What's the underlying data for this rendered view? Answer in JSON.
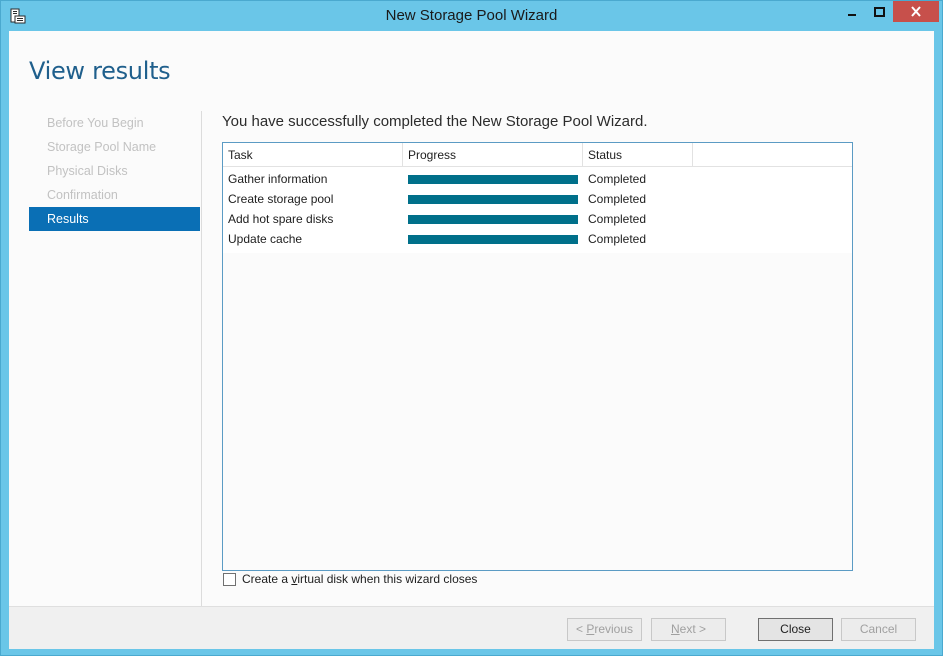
{
  "window": {
    "title": "New Storage Pool Wizard"
  },
  "page": {
    "title": "View results",
    "headline": "You have successfully completed the New Storage Pool Wizard."
  },
  "nav": {
    "items": [
      {
        "label": "Before You Begin",
        "state": "disabled"
      },
      {
        "label": "Storage Pool Name",
        "state": "disabled"
      },
      {
        "label": "Physical Disks",
        "state": "disabled"
      },
      {
        "label": "Confirmation",
        "state": "disabled"
      },
      {
        "label": "Results",
        "state": "active"
      }
    ]
  },
  "grid": {
    "columns": {
      "task": "Task",
      "progress": "Progress",
      "status": "Status"
    },
    "rows": [
      {
        "task": "Gather information",
        "progress": 1.0,
        "status": "Completed"
      },
      {
        "task": "Create storage pool",
        "progress": 1.0,
        "status": "Completed"
      },
      {
        "task": "Add hot spare disks",
        "progress": 1.0,
        "status": "Completed"
      },
      {
        "task": "Update cache",
        "progress": 1.0,
        "status": "Completed"
      }
    ]
  },
  "options": {
    "create_vdisk_pre": "Create a ",
    "create_vdisk_accel": "v",
    "create_vdisk_post": "irtual disk when this wizard closes",
    "create_vdisk_checked": false
  },
  "buttons": {
    "previous_pre": "< ",
    "previous_accel": "P",
    "previous_post": "revious",
    "next_accel": "N",
    "next_post": "ext >",
    "close": "Close",
    "cancel": "Cancel"
  },
  "colors": {
    "frame": "#6ac6e8",
    "accent": "#0a6fb5",
    "progress_fill": "#00708a",
    "title_blue": "#1f5f8c",
    "close_button": "#c7504b"
  }
}
